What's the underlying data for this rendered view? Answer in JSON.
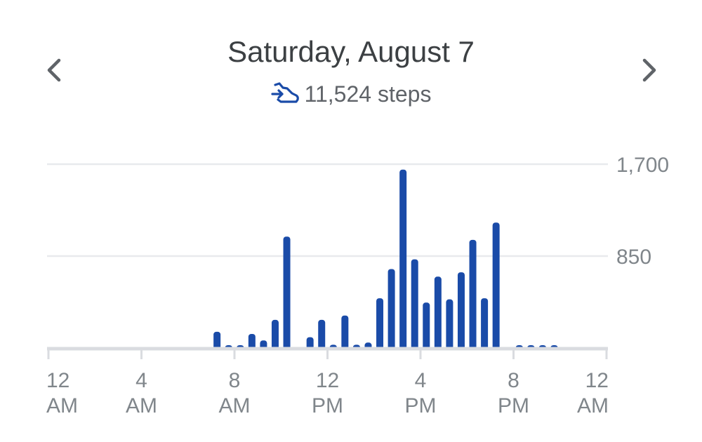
{
  "header": {
    "date": "Saturday, August 7",
    "steps_text": "11,524 steps",
    "prev_icon": "chevron-left-icon",
    "next_icon": "chevron-right-icon",
    "steps_icon": "steps-icon"
  },
  "colors": {
    "bar": "#1a4ba8",
    "grid": "#e8eaed",
    "axis": "#dadce0",
    "text": "#3c4043",
    "muted": "#80868b",
    "icon_blue": "#1a4ba8"
  },
  "chart_data": {
    "type": "bar",
    "title": "",
    "xlabel": "",
    "ylabel": "",
    "ylim": [
      0,
      1700
    ],
    "yticks": [
      {
        "value": 1700,
        "label": "1,700"
      },
      {
        "value": 850,
        "label": "850"
      }
    ],
    "xticks": [
      {
        "hour": 0,
        "line1": "12",
        "line2": "AM"
      },
      {
        "hour": 4,
        "line1": "4",
        "line2": "AM"
      },
      {
        "hour": 8,
        "line1": "8",
        "line2": "AM"
      },
      {
        "hour": 12,
        "line1": "12",
        "line2": "PM"
      },
      {
        "hour": 16,
        "line1": "4",
        "line2": "PM"
      },
      {
        "hour": 20,
        "line1": "8",
        "line2": "PM"
      },
      {
        "hour": 24,
        "line1": "12",
        "line2": "AM"
      }
    ],
    "interval_minutes": 30,
    "series": [
      {
        "values": [
          {
            "hour": 7.0,
            "value": 150
          },
          {
            "hour": 7.5,
            "value": 20
          },
          {
            "hour": 8.0,
            "value": 15
          },
          {
            "hour": 8.5,
            "value": 130
          },
          {
            "hour": 9.0,
            "value": 70
          },
          {
            "hour": 9.5,
            "value": 260
          },
          {
            "hour": 10.0,
            "value": 1030
          },
          {
            "hour": 11.0,
            "value": 100
          },
          {
            "hour": 11.5,
            "value": 260
          },
          {
            "hour": 12.0,
            "value": 30
          },
          {
            "hour": 12.5,
            "value": 300
          },
          {
            "hour": 13.0,
            "value": 30
          },
          {
            "hour": 13.5,
            "value": 50
          },
          {
            "hour": 14.0,
            "value": 460
          },
          {
            "hour": 14.5,
            "value": 730
          },
          {
            "hour": 15.0,
            "value": 1650
          },
          {
            "hour": 15.5,
            "value": 820
          },
          {
            "hour": 16.0,
            "value": 420
          },
          {
            "hour": 16.5,
            "value": 660
          },
          {
            "hour": 17.0,
            "value": 450
          },
          {
            "hour": 17.5,
            "value": 700
          },
          {
            "hour": 18.0,
            "value": 1000
          },
          {
            "hour": 18.5,
            "value": 460
          },
          {
            "hour": 19.0,
            "value": 1160
          },
          {
            "hour": 20.0,
            "value": 10
          },
          {
            "hour": 20.5,
            "value": 8
          },
          {
            "hour": 21.0,
            "value": 18
          },
          {
            "hour": 21.5,
            "value": 12
          }
        ]
      }
    ],
    "grid": true
  }
}
